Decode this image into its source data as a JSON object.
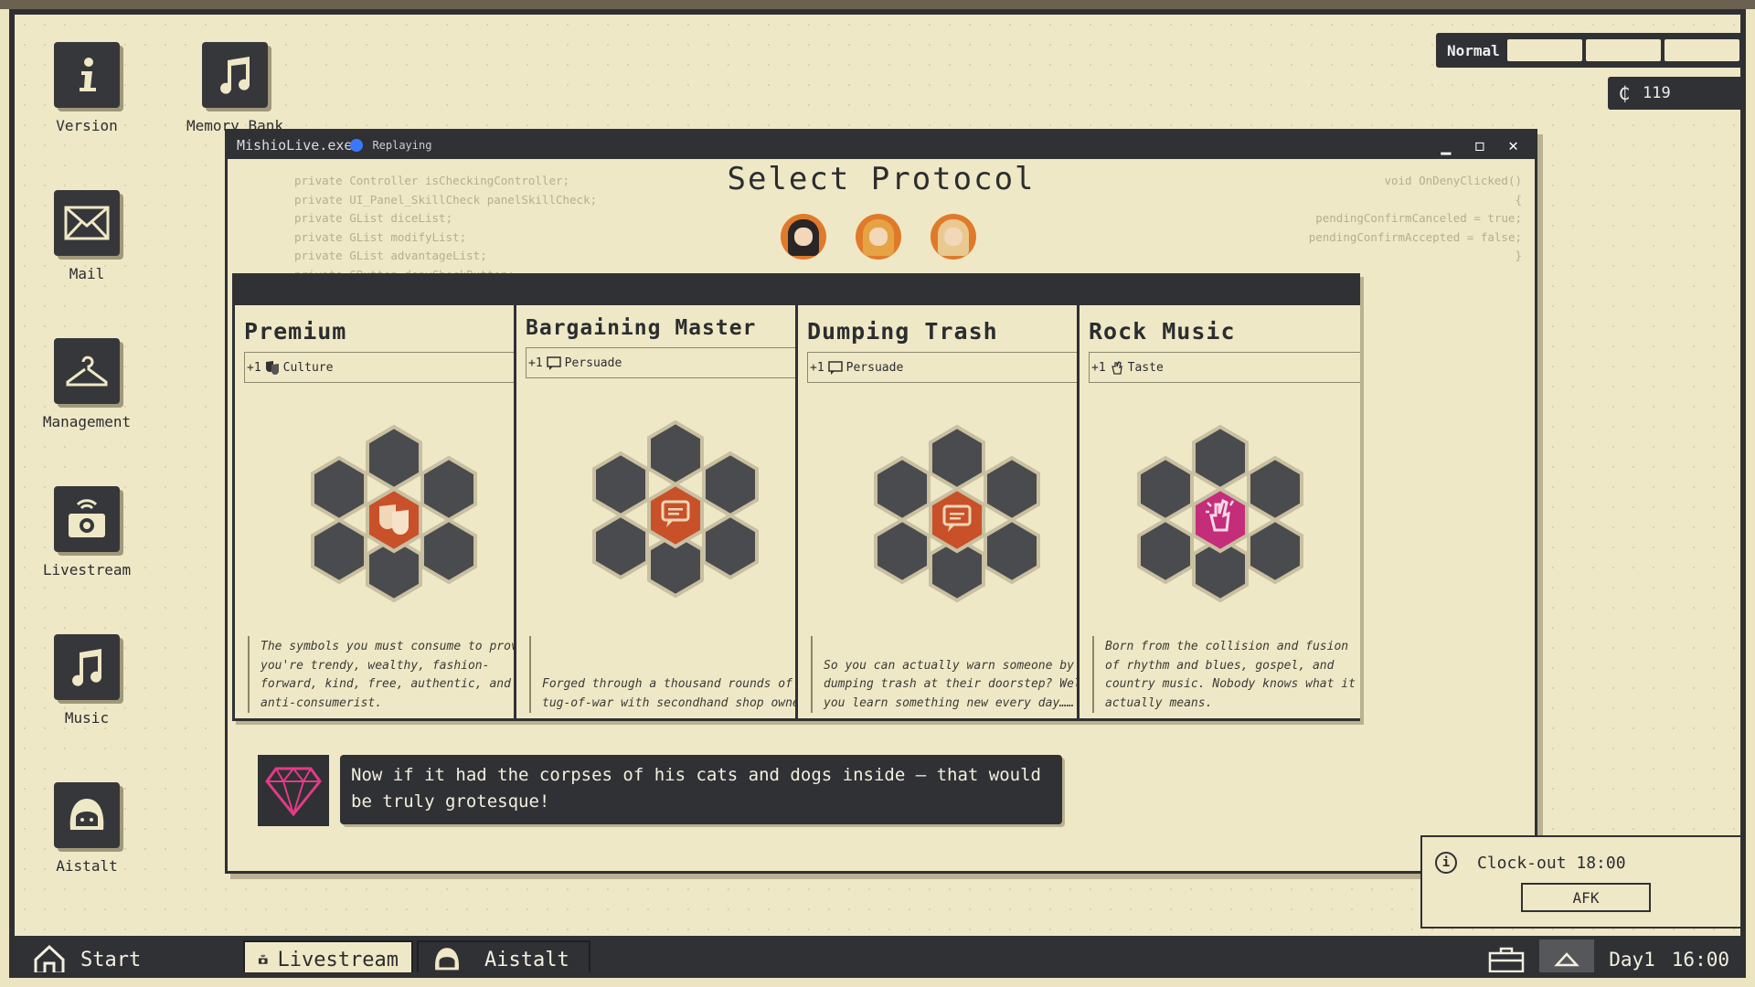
{
  "desktop": {
    "icons": [
      {
        "label": "Version"
      },
      {
        "label": "Memory Bank"
      },
      {
        "label": "Mail"
      },
      {
        "label": "Management"
      },
      {
        "label": "Livestream"
      },
      {
        "label": "Music"
      },
      {
        "label": "Aistalt"
      }
    ]
  },
  "status": {
    "mode": "Normal",
    "mode_segments": 3,
    "coins": "119"
  },
  "window": {
    "title": "MishioLive.exe",
    "replaying": "Replaying",
    "heading": "Select Protocol",
    "code_left": "private Controller isCheckingController;\nprivate UI_Panel_SkillCheck panelSkillCheck;\nprivate GList diceList;\nprivate GList modifyList;\nprivate GList advantageList;\nprivate GButton denyCheckButton;",
    "code_right": "void OnDenyClicked()\n{\npendingConfirmCanceled = true;\npendingConfirmAccepted = false;\n}"
  },
  "cards": [
    {
      "title": "Premium",
      "stat": "+1",
      "stat_name": "Culture",
      "center_color": "#c8512a",
      "symbol": "theater-masks",
      "desc": "The symbols you must consume to prove you're trendy, wealthy, fashion-forward, kind, free, authentic, and anti-consumerist."
    },
    {
      "title": "Bargaining Master",
      "stat": "+1",
      "stat_name": "Persuade",
      "center_color": "#c8512a",
      "symbol": "speech-bubble",
      "desc": "Forged through a thousand rounds of tug-of-war with secondhand shop owners."
    },
    {
      "title": "Dumping Trash",
      "stat": "+1",
      "stat_name": "Persuade",
      "center_color": "#c8512a",
      "symbol": "speech-bubble",
      "desc": "So you can actually warn someone by dumping trash at their doorstep? Well, you learn something new every day……"
    },
    {
      "title": "Rock Music",
      "stat": "+1",
      "stat_name": "Taste",
      "center_color": "#c42d7a",
      "symbol": "taste-hand",
      "desc": "Born from the collision and fusion of rhythm and blues, gospel, and country music. Nobody knows what it actually means."
    }
  ],
  "dialog": {
    "text": "Now if it had the corpses of his cats and dogs inside — that would be truly grotesque!",
    "portrait": "diamond"
  },
  "clock": {
    "text": "Clock-out 18:00",
    "button": "AFK"
  },
  "taskbar": {
    "start": "Start",
    "items": [
      "Livestream",
      "Aistalt"
    ],
    "day": "Day1",
    "time": "16:00"
  }
}
